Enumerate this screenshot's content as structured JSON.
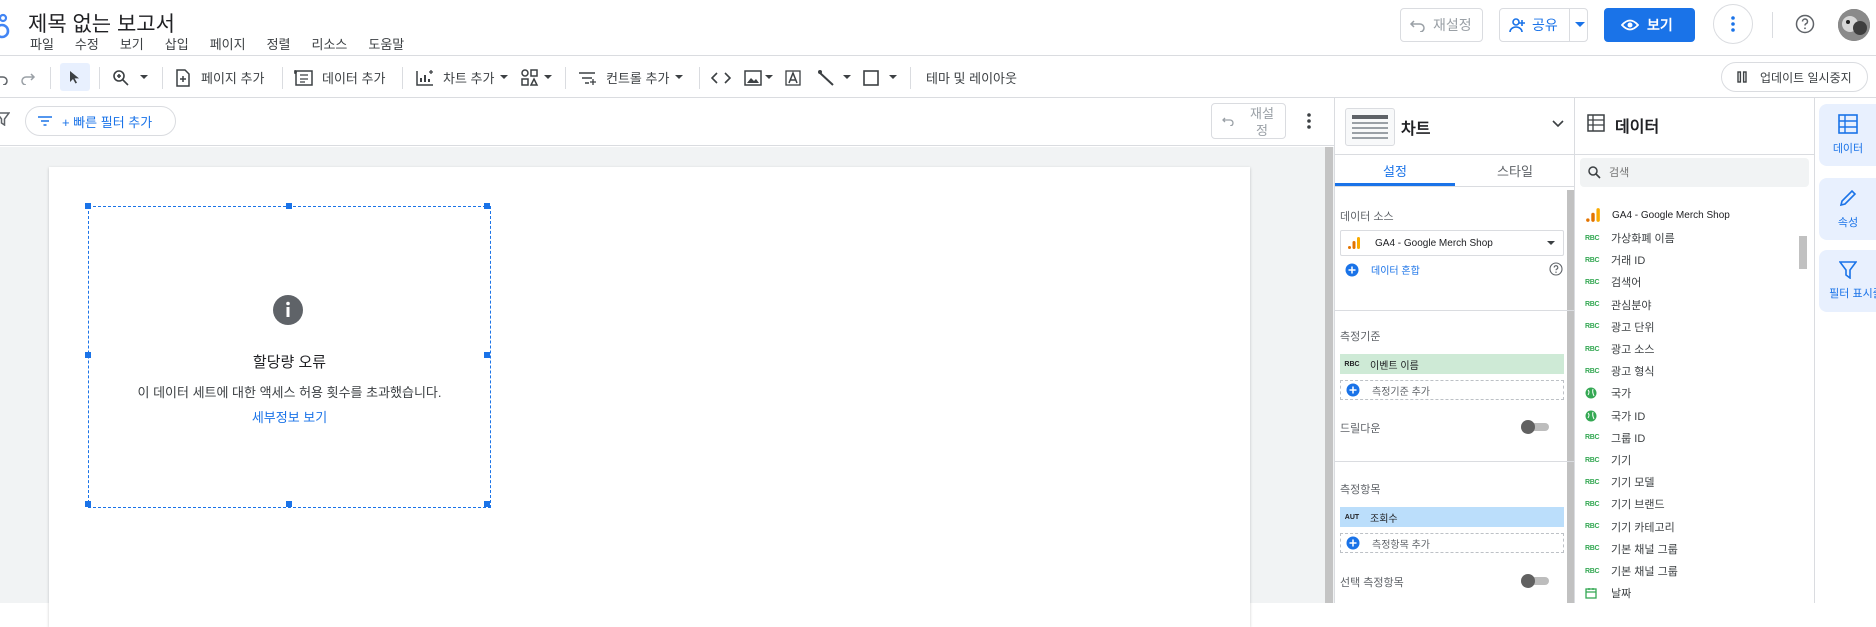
{
  "header": {
    "title": "제목 없는 보고서",
    "menu": [
      "파일",
      "수정",
      "보기",
      "삽입",
      "페이지",
      "정렬",
      "리소스",
      "도움말"
    ],
    "reset_label": "재설정",
    "share_label": "공유",
    "view_label": "보기"
  },
  "toolbar": {
    "add_page": "페이지 추가",
    "add_data": "데이터 추가",
    "add_chart": "차트 추가",
    "add_control": "컨트롤 추가",
    "theme_layout": "테마 및 레이아웃",
    "pause_updates": "업데이트 일시중지"
  },
  "filterbar": {
    "quick_filter": "+ 빠른 필터 추가",
    "reset_label": "재설\n정"
  },
  "chart": {
    "error_title": "할당량 오류",
    "error_message": "이 데이터 세트에 대한 액세스 허용 횟수를 초과했습니다.",
    "details_link": "세부정보 보기"
  },
  "props": {
    "title": "차트",
    "tabs": [
      "설정",
      "스타일"
    ],
    "data_source_label": "데이터 소스",
    "data_source_value": "GA4 - Google Merch Shop",
    "blend_label": "데이터 혼합",
    "dimension_label": "측정기준",
    "dimension_type": "RBC",
    "dimension_value": "이벤트 이름",
    "add_dimension": "측정기준 추가",
    "drilldown_label": "드릴다운",
    "metric_label": "측정항목",
    "metric_type": "AUT",
    "metric_value": "조회수",
    "add_metric": "측정항목 추가",
    "optional_metric_label": "선택 측정항목"
  },
  "datapanel": {
    "title": "데이터",
    "search_placeholder": "검색",
    "source_name": "GA4 - Google Merch Shop",
    "fields": [
      {
        "type": "RBC",
        "name": "가상화폐 이름"
      },
      {
        "type": "RBC",
        "name": "거래 ID"
      },
      {
        "type": "RBC",
        "name": "검색어"
      },
      {
        "type": "RBC",
        "name": "관심분야"
      },
      {
        "type": "RBC",
        "name": "광고 단위"
      },
      {
        "type": "RBC",
        "name": "광고 소스"
      },
      {
        "type": "RBC",
        "name": "광고 형식"
      },
      {
        "type": "globe",
        "name": "국가"
      },
      {
        "type": "globe",
        "name": "국가 ID"
      },
      {
        "type": "RBC",
        "name": "그룹 ID"
      },
      {
        "type": "RBC",
        "name": "기기"
      },
      {
        "type": "RBC",
        "name": "기기 모델"
      },
      {
        "type": "RBC",
        "name": "기기 브랜드"
      },
      {
        "type": "RBC",
        "name": "기기 카테고리"
      },
      {
        "type": "RBC",
        "name": "기본 채널 그룹"
      },
      {
        "type": "RBC",
        "name": "기본 채널 그룹"
      },
      {
        "type": "date",
        "name": "날짜"
      }
    ]
  },
  "rail": {
    "data": "데이터",
    "properties": "속성",
    "filter": "필터 표시줄"
  },
  "colors": {
    "accent": "#1a73e8",
    "dimension_chip": "#ceead6",
    "metric_chip": "#bbdefb",
    "ga_orange": "#f9ab00"
  }
}
